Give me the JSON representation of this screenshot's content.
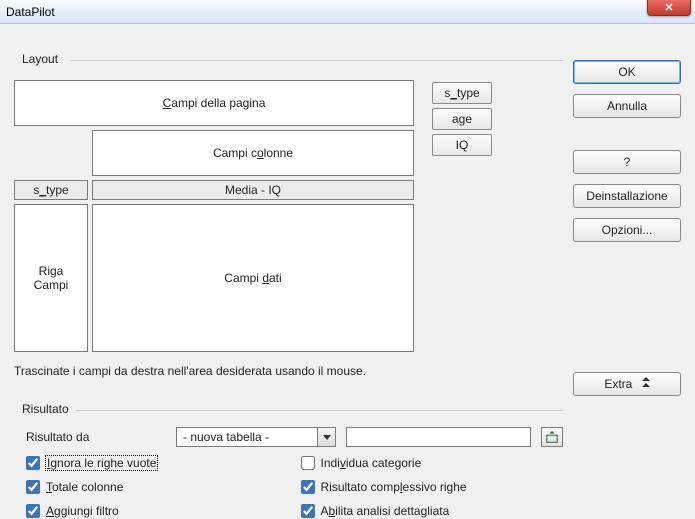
{
  "window": {
    "title": "DataPilot",
    "close_glyph": "✕"
  },
  "buttons": {
    "ok": "OK",
    "cancel": "Annulla",
    "help": "?",
    "uninstall": "Deinstallazione",
    "options": "Opzioni...",
    "extra": "Extra"
  },
  "layout": {
    "group_label": "Layout",
    "page_fields_label_pre": "",
    "page_fields_label_u": "C",
    "page_fields_label_post": "ampi della pagina",
    "column_fields_label_pre": "Campi c",
    "column_fields_label_u": "o",
    "column_fields_label_post": "lonne",
    "row_header_pre": "s",
    "row_header_u": "_",
    "row_header_post": "type",
    "data_header": "Media - IQ",
    "row_fields_label1": "Riga",
    "row_fields_label2": "Campi",
    "data_fields_label_pre": "Campi ",
    "data_fields_label_u": "d",
    "data_fields_label_post": "ati",
    "available_fields": {
      "f1_pre": "s",
      "f1_u": "_",
      "f1_post": "type",
      "f2": "age",
      "f3": "IQ"
    },
    "hint": "Trascinate i campi da destra nell'area desiderata usando il mouse."
  },
  "result": {
    "group_label": "Risultato",
    "from_label": "Risultato da",
    "combo_value": "- nuova tabella -",
    "dest_value": "",
    "checks": {
      "ignore_pre": "",
      "ignore_u": "I",
      "ignore_post": "gnora le righe vuote",
      "identcat_pre": "Indi",
      "identcat_u": "v",
      "identcat_post": "idua categorie",
      "totcols_pre": "",
      "totcols_u": "T",
      "totcols_post": "otale colonne",
      "totrows_pre": "Risultato comp",
      "totrows_u": "l",
      "totrows_post": "essivo righe",
      "addfilter_pre": "",
      "addfilter_u": "A",
      "addfilter_post": "ggiungi filtro",
      "drill_pre": "A",
      "drill_u": "b",
      "drill_post": "ilita analisi dettagliata"
    },
    "checked": {
      "ignore": true,
      "identcat": false,
      "totcols": true,
      "totrows": true,
      "addfilter": true,
      "drill": true
    }
  }
}
